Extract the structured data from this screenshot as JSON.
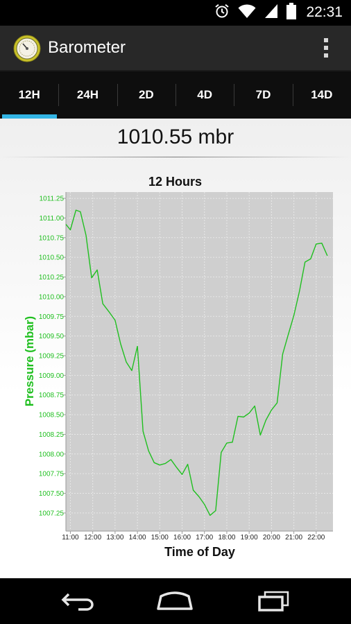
{
  "status_bar": {
    "time": "22:31",
    "icons": [
      "alarm-icon",
      "wifi-icon",
      "signal-icon",
      "battery-icon"
    ]
  },
  "app": {
    "title": "Barometer",
    "icon": "barometer-icon",
    "menu_icon": "overflow-menu-icon"
  },
  "tabs": [
    {
      "label": "12H",
      "active": true
    },
    {
      "label": "24H",
      "active": false
    },
    {
      "label": "2D",
      "active": false
    },
    {
      "label": "4D",
      "active": false
    },
    {
      "label": "7D",
      "active": false
    },
    {
      "label": "14D",
      "active": false
    }
  ],
  "reading": "1010.55 mbr",
  "colors": {
    "accent": "#33b5e5",
    "series": "#1fbf1f",
    "plot_bg": "#cfcfcf",
    "grid": "#e8e8e8"
  },
  "chart_data": {
    "type": "line",
    "title": "12 Hours",
    "xlabel": "Time of Day",
    "ylabel": "Pressure (mbar)",
    "x_ticks": [
      "11:00",
      "12:00",
      "13:00",
      "14:00",
      "15:00",
      "16:00",
      "17:00",
      "18:00",
      "19:00",
      "20:00",
      "21:00",
      "22:00"
    ],
    "x_tick_hours": [
      11,
      12,
      13,
      14,
      15,
      16,
      17,
      18,
      19,
      20,
      21,
      22
    ],
    "y_ticks": [
      1007.25,
      1007.5,
      1007.75,
      1008.0,
      1008.25,
      1008.5,
      1008.75,
      1009.0,
      1009.25,
      1009.5,
      1009.75,
      1010.0,
      1010.25,
      1010.5,
      1010.75,
      1011.0,
      1011.25
    ],
    "y_tick_labels": [
      "1007.25",
      "1007.50",
      "1007.75",
      "1008.00",
      "1008.25",
      "1008.50",
      "1008.75",
      "1009.00",
      "1009.25",
      "1009.50",
      "1009.75",
      "1010.00",
      "1010.25",
      "1010.50",
      "1010.75",
      "1011.00",
      "1011.25"
    ],
    "xlim": [
      10.8,
      22.75
    ],
    "ylim": [
      1007.02,
      1011.33
    ],
    "grid": true,
    "series": [
      {
        "x": [
          10.8,
          11.0,
          11.25,
          11.45,
          11.7,
          11.95,
          12.2,
          12.45,
          12.75,
          13.0,
          13.25,
          13.5,
          13.75,
          14.0,
          14.25,
          14.5,
          14.75,
          15.0,
          15.25,
          15.5,
          15.75,
          16.0,
          16.25,
          16.5,
          16.75,
          17.0,
          17.25,
          17.5,
          17.75,
          18.0,
          18.25,
          18.5,
          18.75,
          19.0,
          19.25,
          19.5,
          19.75,
          20.0,
          20.25,
          20.5,
          20.75,
          21.0,
          21.25,
          21.5,
          21.75,
          22.0,
          22.25,
          22.5
        ],
        "y": [
          1010.92,
          1010.85,
          1011.1,
          1011.08,
          1010.78,
          1010.24,
          1010.34,
          1009.91,
          1009.8,
          1009.7,
          1009.4,
          1009.17,
          1009.06,
          1009.37,
          1008.29,
          1008.04,
          1007.89,
          1007.86,
          1007.88,
          1007.93,
          1007.83,
          1007.74,
          1007.87,
          1007.54,
          1007.46,
          1007.36,
          1007.22,
          1007.28,
          1008.02,
          1008.14,
          1008.15,
          1008.48,
          1008.47,
          1008.52,
          1008.61,
          1008.24,
          1008.43,
          1008.56,
          1008.65,
          1009.27,
          1009.52,
          1009.76,
          1010.07,
          1010.44,
          1010.48,
          1010.67,
          1010.68,
          1010.52
        ]
      }
    ]
  }
}
